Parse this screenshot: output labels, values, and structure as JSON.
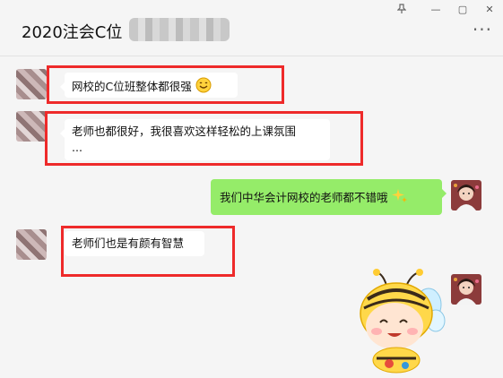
{
  "window": {
    "pin_icon": "pin-icon",
    "minimize_label": "—",
    "maximize_label": "▢",
    "close_label": "✕"
  },
  "header": {
    "title": "2020注会C位",
    "more_label": "···"
  },
  "messages": [
    {
      "side": "left",
      "text": "网校的C位班整体都很强",
      "emoji": "smile-emoji"
    },
    {
      "side": "left",
      "text": "老师也都很好，我很喜欢这样轻松的上课氛围",
      "text_cont": "..."
    },
    {
      "side": "right",
      "text": "我们中华会计网校的老师都不错哦",
      "emoji": "sparkles-emoji"
    },
    {
      "side": "left",
      "text": "老师们也是有颜有智慧"
    },
    {
      "side": "right",
      "sticker": "bee-sticker"
    }
  ],
  "colors": {
    "highlight_box": "#ee2a2a",
    "self_bubble": "#95ec69",
    "other_bubble": "#ffffff",
    "background": "#f5f5f5"
  }
}
